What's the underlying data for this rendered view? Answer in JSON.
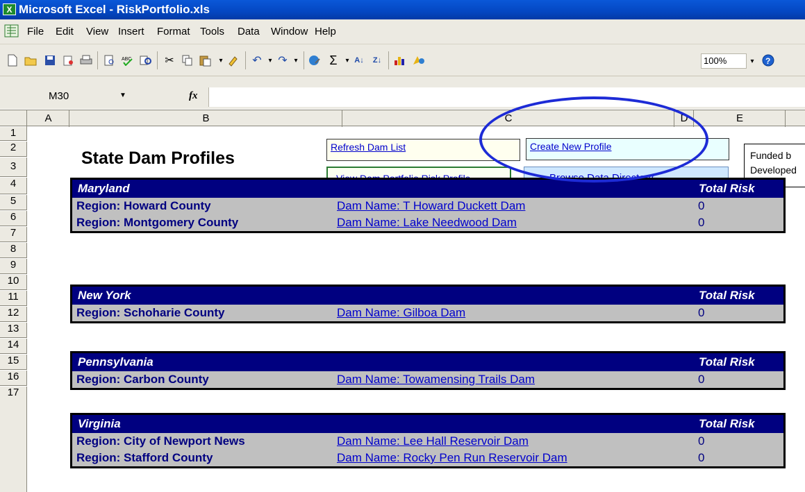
{
  "window": {
    "title": "Microsoft Excel - RiskPortfolio.xls",
    "icon": "excel-app-icon"
  },
  "menu": [
    "File",
    "Edit",
    "View",
    "Insert",
    "Format",
    "Tools",
    "Data",
    "Window",
    "Help"
  ],
  "toolbar": {
    "icons": [
      "new-icon",
      "open-icon",
      "save-icon",
      "permission-icon",
      "print-icon",
      "print-preview-icon",
      "spelling-icon",
      "research-icon",
      "cut-icon",
      "copy-icon",
      "paste-icon",
      "format-painter-icon",
      "undo-icon",
      "redo-icon",
      "hyperlink-icon",
      "autosum-icon",
      "sort-ascending-icon",
      "sort-descending-icon",
      "chart-wizard-icon",
      "drawing-icon",
      "help-icon"
    ],
    "zoom": "100%"
  },
  "formula_bar": {
    "name_box": "M30",
    "fx": "fx",
    "formula": ""
  },
  "columns": [
    "A",
    "B",
    "C",
    "D",
    "E"
  ],
  "rows": [
    "1",
    "2",
    "3",
    "4",
    "5",
    "6",
    "7",
    "8",
    "9",
    "10",
    "11",
    "12",
    "13",
    "14",
    "15",
    "16",
    "17"
  ],
  "sheet": {
    "title": "State Dam Profiles",
    "buttons": {
      "refresh": "Refresh Dam List",
      "create": "Create New Profile",
      "view": "View Dam Portfolio Risk Profile",
      "browse": "Browse Data Directory"
    },
    "funded_lines": [
      "Funded b",
      "Developed"
    ],
    "total_risk_label": "Total Risk",
    "states": [
      {
        "name": "Maryland",
        "rows": [
          {
            "region": "Region: Howard County",
            "dam": "Dam Name: T Howard Duckett Dam",
            "risk": "0"
          },
          {
            "region": "Region: Montgomery County",
            "dam": "Dam Name: Lake Needwood Dam",
            "risk": "0"
          }
        ]
      },
      {
        "name": "New York",
        "rows": [
          {
            "region": "Region: Schoharie County",
            "dam": "Dam Name: Gilboa Dam",
            "risk": "0"
          }
        ]
      },
      {
        "name": "Pennsylvania",
        "rows": [
          {
            "region": "Region: Carbon County",
            "dam": "Dam Name: Towamensing Trails Dam",
            "risk": "0"
          }
        ]
      },
      {
        "name": "Virginia",
        "rows": [
          {
            "region": "Region: City of Newport News",
            "dam": "Dam Name: Lee Hall Reservoir Dam",
            "risk": "0"
          },
          {
            "region": "Region: Stafford County",
            "dam": "Dam Name: Rocky Pen Run Reservoir Dam",
            "risk": "0"
          }
        ]
      }
    ]
  }
}
